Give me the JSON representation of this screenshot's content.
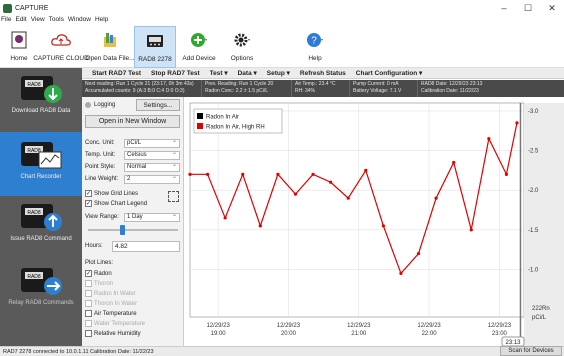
{
  "window": {
    "title": "CAPTURE",
    "minimize": "–",
    "maximize": "☐",
    "close": "✕"
  },
  "menu": [
    "File",
    "Edit",
    "View",
    "Tools",
    "Window",
    "Help"
  ],
  "ribbon": {
    "buttons": [
      {
        "label": "Home",
        "icon": "home-icon"
      },
      {
        "label": "CAPTURE CLOUD",
        "icon": "cloud-icon"
      },
      {
        "label": "Open Data File...",
        "icon": "open-file-icon"
      },
      {
        "label": "RAD8 2278",
        "icon": "rad8-device-icon",
        "active": true
      },
      {
        "label": "Add Device",
        "icon": "add-device-icon"
      },
      {
        "label": "Options",
        "icon": "gear-icon"
      },
      {
        "label": "Help",
        "icon": "help-icon"
      }
    ]
  },
  "left_panel": {
    "items": [
      {
        "label": "Download RAD8 Data",
        "active": false
      },
      {
        "label": "Chart Recorder",
        "active": true
      },
      {
        "label": "Issue RAD8 Command",
        "active": false
      },
      {
        "label": "Relay RAD8 Commands",
        "active": false,
        "disabled": true
      }
    ],
    "device_tag": "RAD8"
  },
  "toolbar": {
    "start": "Start RAD7 Test",
    "stop": "Stop RAD7 Test",
    "test": "Test ▾",
    "data": "Data ▾",
    "setup": "Setup ▾",
    "refresh": "Refresh Status",
    "chartconf": "Chart Configuration ▾"
  },
  "info": {
    "c1a": "Next reading: Run 1 Cycle 21 (23:17, 0h 3m 43s)",
    "c1b": "Accumulated counts: 9 (A:3 B:0 C:4 D:0 O:3)",
    "c2a": "Prev. Reading: Run 1 Cycle 20",
    "c2b": "Radon Conc: 2.2 ± 1.5 pCi/L",
    "c3a": "Air Temp.: 23.4 °C",
    "c3b": "RH: 34%",
    "c4a": "Pump Current: 0 mA",
    "c4b": "Battery Voltage: 7.1 V",
    "c5a": "RAD8 Date: 12/29/23 23:13",
    "c5b": "Calibration Date: 11/22/23"
  },
  "settings": {
    "logging": "Logging",
    "settings_btn": "Settings...",
    "open_window": "Open in New Window",
    "conc_unit_label": "Conc. Unit:",
    "conc_unit": "pCi/L",
    "temp_unit_label": "Temp. Unit:",
    "temp_unit": "Celsius",
    "point_style_label": "Point Style:",
    "point_style": "Normal",
    "line_weight_label": "Line Weight:",
    "line_weight": "2",
    "show_grid": "Show Grid Lines",
    "show_legend": "Show Chart Legend",
    "view_range_label": "View Range:",
    "view_range": "1 Day",
    "hours_label": "Hours:",
    "hours": "4.82",
    "plot_lines": "Plot Lines:",
    "radon": "Radon",
    "thoron": "Thoron",
    "radon_water": "Radon In Water",
    "thoron_water": "Thoron In Water",
    "air_temp": "Air Temperature",
    "water_temp": "Water Temperature",
    "rel_humidity": "Relative Humidity"
  },
  "status": {
    "text": "RAD7 2278 connected to 10.0.1.11 Calibration Date: 11/22/23",
    "scan": "Scan for Devices"
  },
  "chart_data": {
    "type": "line",
    "legend": [
      "Radon In Air",
      "Radon In Air, High RH"
    ],
    "legend_placement": "top-left",
    "y_ticks": [
      "3.0",
      "2.5",
      "2.0",
      "1.5",
      "1.0"
    ],
    "ylim": [
      0.4,
      3.1
    ],
    "y_axis_unit_1": "222Rn",
    "y_axis_unit_2": "pCi/L",
    "x_ticks": [
      {
        "date": "12/29/23",
        "time": "19:00"
      },
      {
        "date": "12/29/23",
        "time": "20:00"
      },
      {
        "date": "12/29/23",
        "time": "21:00"
      },
      {
        "date": "12/29/23",
        "time": "22:00"
      },
      {
        "date": "12/29/23",
        "time": "23:00"
      }
    ],
    "x": [
      18.6,
      18.85,
      19.1,
      19.35,
      19.6,
      19.85,
      20.1,
      20.35,
      20.6,
      20.85,
      21.1,
      21.35,
      21.6,
      21.85,
      22.1,
      22.35,
      22.6,
      22.85,
      23.1,
      23.25
    ],
    "values": [
      2.2,
      2.2,
      1.65,
      2.2,
      1.55,
      2.2,
      1.95,
      2.2,
      2.1,
      1.9,
      2.25,
      1.55,
      0.95,
      1.2,
      1.9,
      2.35,
      1.5,
      2.65,
      2.2,
      2.85
    ],
    "x_range": [
      18.6,
      23.35
    ],
    "readout": "23:13",
    "grid": true,
    "series_color": "#e00000"
  }
}
